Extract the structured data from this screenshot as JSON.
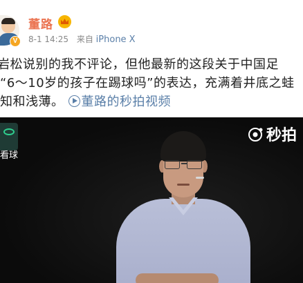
{
  "post": {
    "username": "董路",
    "time": "8-1 14:25",
    "source_prefix": "来自",
    "device": "iPhone X",
    "text_lines": [
      "岩松说别的我不评论，但他最新的这段关于中国足",
      "“6～10岁的孩子在踢球吗”的表达，充满着井底之蛙",
      "知和浅薄。"
    ],
    "video_link": "董路的秒拍视频"
  },
  "video": {
    "side_label": "看球",
    "watermark": "秒拍"
  },
  "colors": {
    "username": "#eb7350",
    "link": "#5a7fa8",
    "meta": "#888888",
    "text": "#222222"
  },
  "icons": {
    "member": "crown-icon",
    "verified": "verified-badge-icon",
    "play": "play-icon",
    "watermark": "miaopai-logo-icon"
  }
}
